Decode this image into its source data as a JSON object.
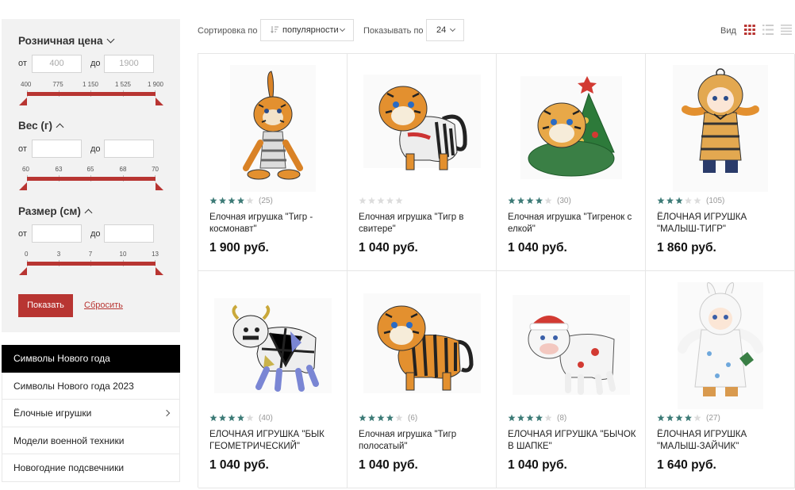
{
  "filters": {
    "price": {
      "title": "Розничная цена",
      "from_label": "от",
      "to_label": "до",
      "from_placeholder": "400",
      "to_placeholder": "1900",
      "ticks": [
        "400",
        "775",
        "1 150",
        "1 525",
        "1 900"
      ]
    },
    "weight": {
      "title": "Вес (г)",
      "from_label": "от",
      "to_label": "до",
      "ticks": [
        "60",
        "63",
        "65",
        "68",
        "70"
      ]
    },
    "size": {
      "title": "Размер (см)",
      "from_label": "от",
      "to_label": "до",
      "ticks": [
        "0",
        "3",
        "7",
        "10",
        "13"
      ]
    },
    "show_label": "Показать",
    "reset_label": "Сбросить",
    "accent_color": "#b83532"
  },
  "categories": [
    {
      "label": "Символы Нового года",
      "active": true
    },
    {
      "label": "Символы Нового года 2023"
    },
    {
      "label": "Ёлочные игрушки",
      "has_children": true
    },
    {
      "label": "Модели военной техники"
    },
    {
      "label": "Новогодние подсвечники"
    }
  ],
  "toolbar": {
    "sort_label": "Сортировка по",
    "sort_value": "популярности",
    "show_label": "Показывать по",
    "show_value": "24",
    "view_label": "Вид",
    "view_icons": [
      "grid-view-icon",
      "list-view-icon",
      "compact-list-icon"
    ]
  },
  "products": [
    {
      "name": "Елочная игрушка \"Тигр - космонавт\"",
      "price": "1 900 руб.",
      "rating": 4,
      "reviews": "(25)",
      "icon": "tiger-astronaut-toy"
    },
    {
      "name": "Елочная игрушка \"Тигр в свитере\"",
      "price": "1 040 руб.",
      "rating": 0,
      "reviews": "",
      "icon": "tiger-sweater-toy"
    },
    {
      "name": "Елочная игрушка \"Тигренок с елкой\"",
      "price": "1 040 руб.",
      "rating": 4,
      "reviews": "(30)",
      "icon": "tiger-cub-tree-toy"
    },
    {
      "name": "ЁЛОЧНАЯ ИГРУШКА \"МАЛЫШ-ТИГР\"",
      "price": "1 860 руб.",
      "rating": 3,
      "reviews": "(105)",
      "icon": "baby-tiger-toy"
    },
    {
      "name": "ЕЛОЧНАЯ ИГРУШКА \"БЫК ГЕОМЕТРИЧЕСКИЙ\"",
      "price": "1 040 руб.",
      "rating": 4,
      "reviews": "(40)",
      "icon": "geometric-bull-toy"
    },
    {
      "name": "Елочная игрушка \"Тигр полосатый\"",
      "price": "1 040 руб.",
      "rating": 4,
      "reviews": "(6)",
      "icon": "striped-tiger-toy"
    },
    {
      "name": "ЕЛОЧНАЯ ИГРУШКА \"БЫЧОК В ШАПКЕ\"",
      "price": "1 040 руб.",
      "rating": 4,
      "reviews": "(8)",
      "icon": "bull-hat-toy"
    },
    {
      "name": "ЁЛОЧНАЯ ИГРУШКА \"МАЛЫШ-ЗАЙЧИК\"",
      "price": "1 640 руб.",
      "rating": 4,
      "reviews": "(27)",
      "icon": "baby-bunny-toy"
    }
  ]
}
